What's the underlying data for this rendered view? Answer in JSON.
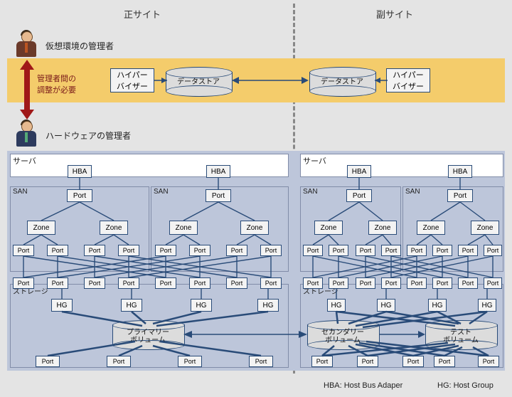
{
  "sites": {
    "primary": "正サイト",
    "secondary": "副サイト"
  },
  "roles": {
    "virtual_admin": "仮想環境の管理者",
    "hw_admin": "ハードウェアの管理者",
    "coord_needed": "管理者間の\n調整が必要"
  },
  "hypervisor_layer": {
    "hypervisor": "ハイパー\nバイザー",
    "datastore": "データストア"
  },
  "hw": {
    "server": "サーバ",
    "hba": "HBA",
    "port": "Port",
    "san": "SAN",
    "zone": "Zone",
    "storage": "ストレージ",
    "hg": "HG",
    "primary_vol": "プライマリー\nボリューム",
    "secondary_vol": "セカンダリー\nボリューム",
    "test_vol": "テスト\nボリューム"
  },
  "legend": {
    "hba": "HBA: Host Bus Adaper",
    "hg": "HG: Host Group"
  }
}
